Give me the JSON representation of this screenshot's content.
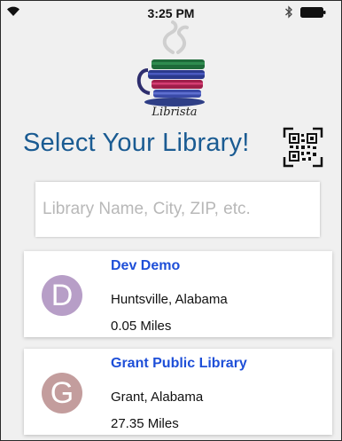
{
  "status_bar": {
    "time": "3:25 PM",
    "icons": [
      "wifi-icon",
      "bluetooth-icon",
      "battery-icon"
    ]
  },
  "logo": {
    "text": "Librista",
    "icon": "coffee-cup-books-icon"
  },
  "header": {
    "title": "Select Your Library!",
    "qr_icon": "qr-code-icon"
  },
  "search": {
    "placeholder": "Library Name, City, ZIP, etc.",
    "value": ""
  },
  "libraries": [
    {
      "initial": "D",
      "name": "Dev Demo",
      "location": "Huntsville, Alabama",
      "distance": "0.05 Miles",
      "avatar_color": "#b79ec7"
    },
    {
      "initial": "G",
      "name": "Grant Public Library",
      "location": "Grant, Alabama",
      "distance": "27.35 Miles",
      "avatar_color": "#c39d9d"
    }
  ],
  "colors": {
    "title": "#1a5b92",
    "library_name": "#1e4fd8",
    "background": "#f0f0f0"
  }
}
